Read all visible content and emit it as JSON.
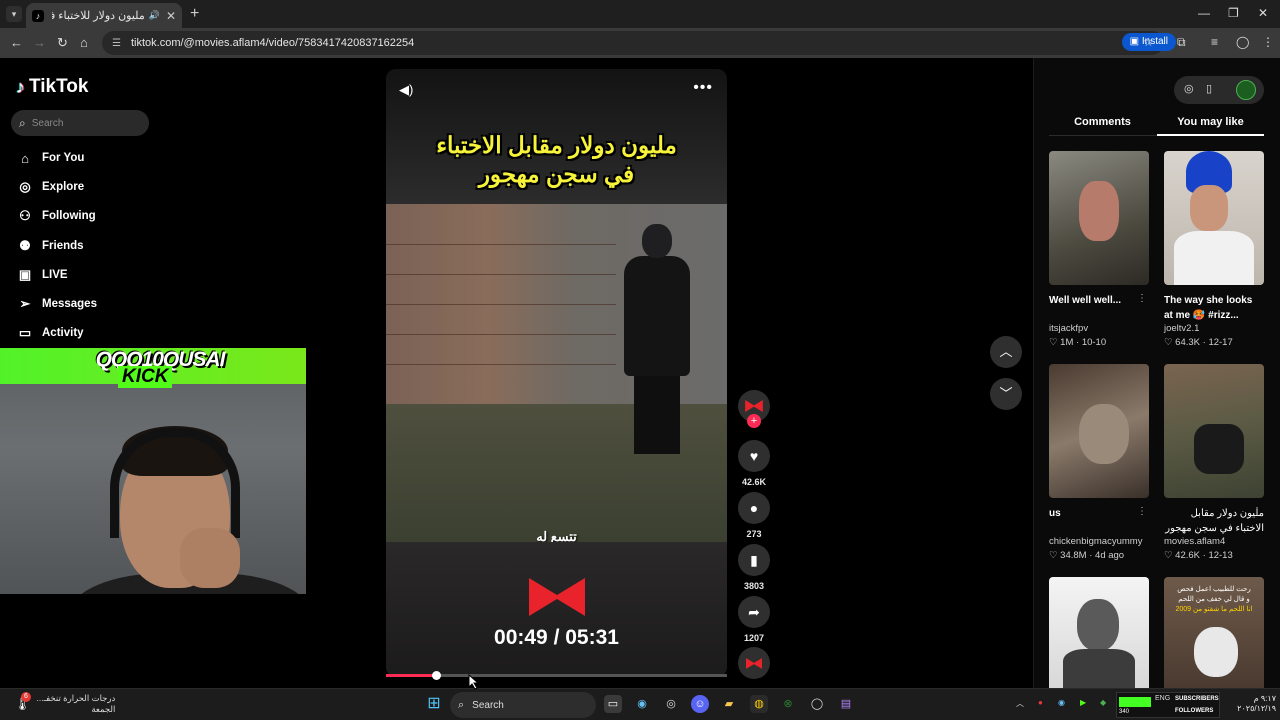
{
  "browser": {
    "tab_title": "مليون دولار للاختباء في سجن",
    "tab_audio_icon": "speaker-icon",
    "url": "tiktok.com/@movies.aflam4/video/7583417420837162254",
    "install_label": "Install"
  },
  "sidebar": {
    "logo": "TikTok",
    "search_placeholder": "Search",
    "items": [
      {
        "label": "For You",
        "icon": "home-icon"
      },
      {
        "label": "Explore",
        "icon": "compass-icon"
      },
      {
        "label": "Following",
        "icon": "person-icon"
      },
      {
        "label": "Friends",
        "icon": "friends-icon"
      },
      {
        "label": "LIVE",
        "icon": "live-icon"
      },
      {
        "label": "Messages",
        "icon": "paper-plane-icon"
      },
      {
        "label": "Activity",
        "icon": "chat-icon"
      }
    ]
  },
  "webcam": {
    "name": "QQQ10QUSAI",
    "platform": "KICK"
  },
  "video": {
    "caption_line1": "مليون دولار مقابل الاختباء",
    "caption_line2": "في سجن مهجور",
    "subtitle": "تتسع له",
    "timer": "00:49 / 05:31",
    "progress_fraction": 0.148
  },
  "actions": {
    "likes": "42.6K",
    "comments": "273",
    "saves": "3803",
    "shares": "1207"
  },
  "right_panel": {
    "tabs": [
      "Comments",
      "You may like"
    ],
    "active_tab": "You may like",
    "cards": [
      {
        "title": "Well well well...",
        "user": "itsjackfpv",
        "likes": "1M",
        "date": "10-10",
        "rtl": false
      },
      {
        "title": "The way she looks at me 🥵 #rizz...",
        "user": "joeltv2.1",
        "likes": "64.3K",
        "date": "12-17",
        "rtl": false
      },
      {
        "title": "us",
        "user": "chickenbigmacyummy",
        "likes": "34.8M",
        "date": "4d ago",
        "rtl": false
      },
      {
        "title": "مليون دولار مقابل الاختباء في سجن مهجور",
        "user": "movies.aflam4",
        "likes": "42.6K",
        "date": "12-13",
        "rtl": true
      },
      {
        "title": "",
        "user": "",
        "likes": "",
        "date": "",
        "rtl": false
      },
      {
        "title": "",
        "user": "",
        "likes": "",
        "date": "",
        "rtl": false
      }
    ],
    "card6_overlay_line1": "رحت للطبيب اعمل فحص",
    "card6_overlay_line2": "و قال لي خفف من اللحم",
    "card6_overlay_line3": "انا اللحم ما شفتو من 2009"
  },
  "taskbar": {
    "weather_line1": "درجات الحرارة تنخفـ...",
    "weather_line2": "الجمعة",
    "badge": "6",
    "search_label": "Search",
    "lang": "ENG",
    "subs_label": "SUBSCRIBERS",
    "followers_label": "FOLLOWERS",
    "subs_count": "340",
    "time": "٩:١٧ م",
    "date": "٢٠٢٥/١٢/١٩"
  },
  "colors": {
    "tiktok_red": "#fe2c55",
    "kick_green": "#53fc18",
    "caption_yellow": "#f7f33a",
    "install_blue": "#0b57d0"
  }
}
